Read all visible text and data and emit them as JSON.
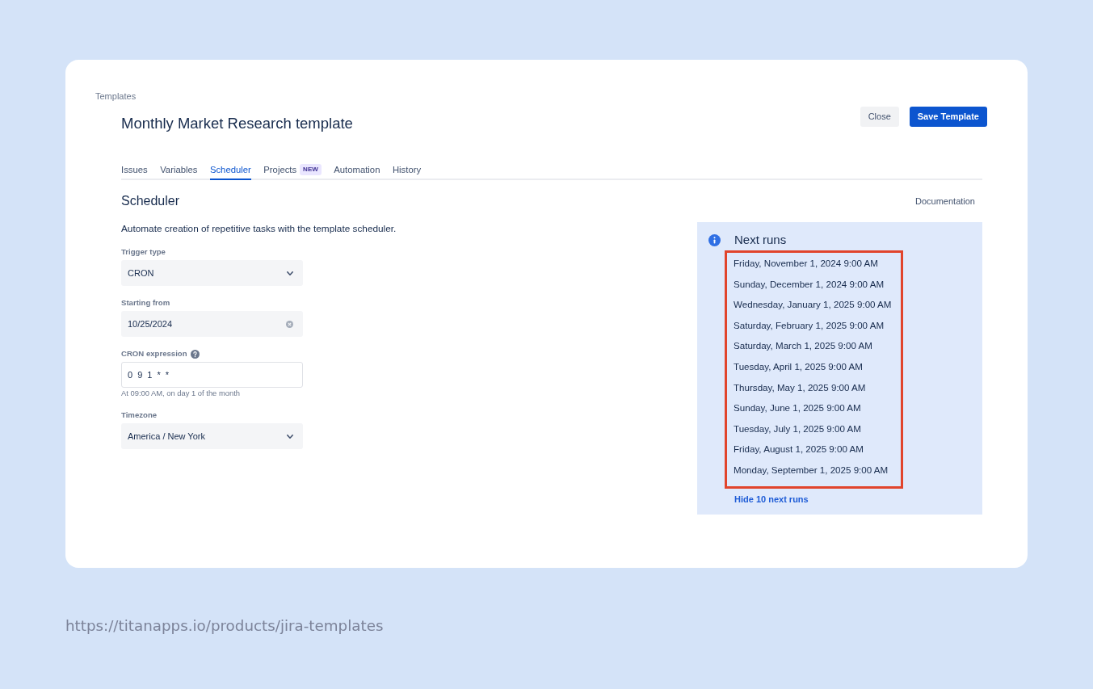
{
  "breadcrumb": "Templates",
  "title": "Monthly Market Research template",
  "buttons": [
    {
      "label": "Close",
      "kind": "secondary"
    },
    {
      "label": "Save Template",
      "kind": "primary"
    }
  ],
  "tabs": [
    {
      "label": "Issues",
      "selected": false
    },
    {
      "label": "Variables",
      "selected": false
    },
    {
      "label": "Scheduler",
      "selected": true
    },
    {
      "label": "Projects",
      "badge": "NEW",
      "selected": false
    },
    {
      "label": "Automation",
      "selected": false
    },
    {
      "label": "History",
      "selected": false
    }
  ],
  "section": {
    "heading": "Scheduler",
    "documentation_link": "Documentation",
    "description": "Automate creation of repetitive tasks with the template scheduler."
  },
  "fields": [
    {
      "kind": "select",
      "label": "Trigger type",
      "value": "CRON"
    },
    {
      "kind": "date",
      "label": "Starting from",
      "value": "10/25/2024"
    },
    {
      "kind": "text",
      "label": "CRON expression",
      "help": true,
      "value": "0 9 1 * *",
      "hint": "At 09:00 AM, on day 1 of the month"
    },
    {
      "kind": "select",
      "label": "Timezone",
      "value": "America / New York"
    }
  ],
  "next_runs": {
    "title": "Next runs",
    "highlighted": true,
    "runs": [
      "Friday, November 1, 2024 9:00 AM",
      "Sunday, December 1, 2024 9:00 AM",
      "Wednesday, January 1, 2025 9:00 AM",
      "Saturday, February 1, 2025 9:00 AM",
      "Saturday, March 1, 2025 9:00 AM",
      "Tuesday, April 1, 2025 9:00 AM",
      "Thursday, May 1, 2025 9:00 AM",
      "Sunday, June 1, 2025 9:00 AM",
      "Tuesday, July 1, 2025 9:00 AM",
      "Friday, August 1, 2025 9:00 AM",
      "Monday, September 1, 2025 9:00 AM"
    ],
    "toggle_link": "Hide 10 next runs"
  },
  "source_url": "https://titanapps.io/products/jira-templates"
}
